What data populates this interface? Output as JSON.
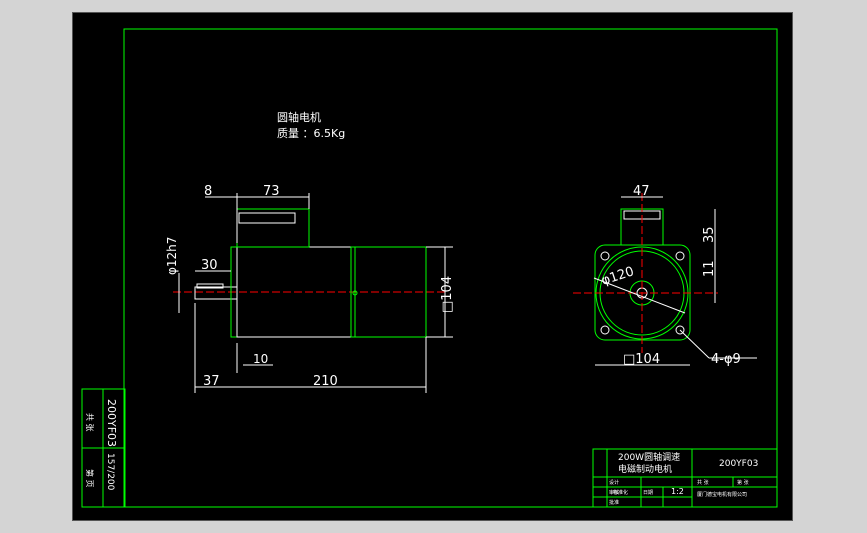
{
  "note": {
    "line1": "圆轴电机",
    "line2": "质量 ：6.5Kg"
  },
  "side_view": {
    "dim_key": "8",
    "dim_box": "73",
    "dim_shaft_dia": "φ12h7",
    "dim_shaft_len": "30",
    "dim_flange_dia": "□104",
    "dim_flange_thk": "10",
    "dim_offset": "37",
    "dim_length": "210"
  },
  "front_view": {
    "dim_box_w": "47",
    "dim_box_h": "35",
    "dim_center_h": "11",
    "dim_pcd": "φ120",
    "dim_square": "□104",
    "dim_holes": "4-φ9"
  },
  "left_strip": {
    "code": "200YF03",
    "ratio": "157/200",
    "label_a": "共 张",
    "label_b": "第 页"
  },
  "title_block": {
    "title_line1": "200W圆轴调速",
    "title_line2": "电磁制动电机",
    "drawing_no": "200YF03",
    "scale": "1:2",
    "cell_a": "共 张",
    "cell_b": "第 张",
    "cell_c": "设计",
    "cell_d": "审核",
    "cell_e": "标准化",
    "cell_f": "日期",
    "cell_g": "批准",
    "company": "厦门德宝电机有限公司"
  },
  "colors": {
    "background": "#000000",
    "border": "#00ff00",
    "outline": "#ffffff",
    "centerline": "#ff0000",
    "text": "#ffffff"
  }
}
